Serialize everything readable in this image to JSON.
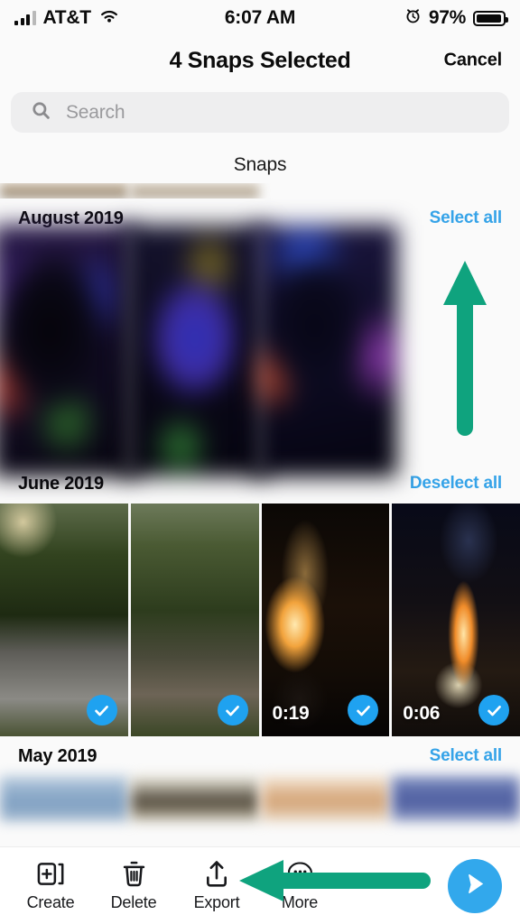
{
  "status_bar": {
    "carrier": "AT&T",
    "time": "6:07 AM",
    "battery_percent": "97%",
    "signal_icon": "cellular-signal-icon",
    "wifi_icon": "wifi-icon",
    "alarm_icon": "alarm-clock-icon",
    "battery_icon": "battery-icon"
  },
  "header": {
    "title": "4 Snaps Selected",
    "cancel_label": "Cancel"
  },
  "search": {
    "placeholder": "Search",
    "value": "",
    "icon": "search-icon"
  },
  "tabs": [
    {
      "label": "Snaps",
      "active": true
    }
  ],
  "sections": [
    {
      "title": "August 2019",
      "action_label": "Select all",
      "action_color": "#35a3e8",
      "items": [
        {
          "selected": false,
          "duration": "",
          "kind": "blurred-photo"
        },
        {
          "selected": false,
          "duration": "",
          "kind": "blurred-photo"
        },
        {
          "selected": false,
          "duration": "",
          "kind": "blurred-photo"
        }
      ]
    },
    {
      "title": "June 2019",
      "action_label": "Deselect all",
      "action_color": "#35a3e8",
      "items": [
        {
          "selected": true,
          "duration": "",
          "kind": "photo-forest-path"
        },
        {
          "selected": true,
          "duration": "",
          "kind": "photo-forest-trail"
        },
        {
          "selected": true,
          "duration": "0:19",
          "kind": "video-bonfire"
        },
        {
          "selected": true,
          "duration": "0:06",
          "kind": "video-bonfire-sparks"
        }
      ]
    },
    {
      "title": "May 2019",
      "action_label": "Select all",
      "action_color": "#35a3e8",
      "items": [
        {
          "selected": false,
          "duration": "",
          "kind": "blurred-photo"
        },
        {
          "selected": false,
          "duration": "",
          "kind": "blurred-photo"
        },
        {
          "selected": false,
          "duration": "",
          "kind": "blurred-photo"
        },
        {
          "selected": false,
          "duration": "",
          "kind": "blurred-photo"
        }
      ]
    }
  ],
  "toolbar": {
    "items": [
      {
        "label": "Create",
        "icon": "create-icon"
      },
      {
        "label": "Delete",
        "icon": "trash-icon"
      },
      {
        "label": "Export",
        "icon": "export-upload-icon"
      },
      {
        "label": "More",
        "icon": "more-dots-icon"
      }
    ],
    "send_icon": "send-arrow-icon",
    "send_color": "#32a8ec"
  },
  "annotations": {
    "color": "#0fa37e",
    "arrows": [
      {
        "name": "arrow-pointing-to-select-all",
        "direction": "up"
      },
      {
        "name": "arrow-pointing-to-export",
        "direction": "left"
      }
    ]
  },
  "selection_check_color": "#1fa2f0"
}
